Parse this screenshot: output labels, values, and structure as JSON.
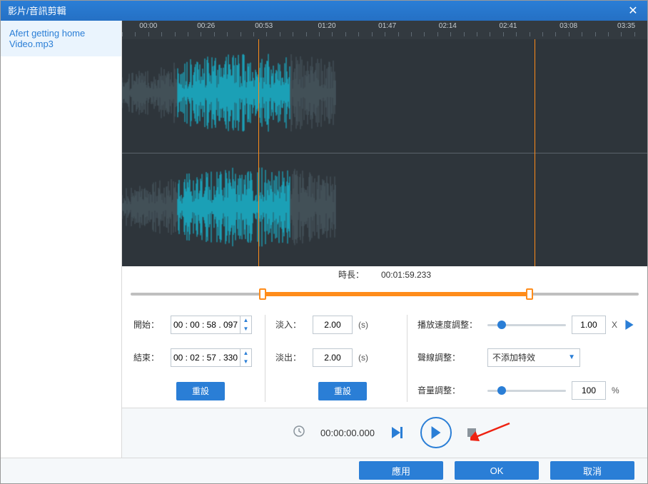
{
  "title": "影片/音訊剪輯",
  "sidebar": {
    "items": [
      {
        "label": "Afert getting home Video.mp3"
      }
    ]
  },
  "ruler": {
    "ticks": [
      "00:00",
      "00:26",
      "00:53",
      "01:20",
      "01:47",
      "02:14",
      "02:41",
      "03:08",
      "03:35"
    ]
  },
  "selection": {
    "left_pct": 26,
    "right_pct": 78.5
  },
  "duration": {
    "label": "時長：",
    "value": "00:01:59.233"
  },
  "trim": {
    "start_label": "開始：",
    "start_value": "00 : 00 : 58 . 097",
    "end_label": "結束：",
    "end_value": "00 : 02 : 57 . 330",
    "reset_label": "重設"
  },
  "fade": {
    "in_label": "淡入：",
    "in_value": "2.00",
    "in_unit": "(s)",
    "out_label": "淡出：",
    "out_value": "2.00",
    "out_unit": "(s)",
    "reset_label": "重設"
  },
  "speed": {
    "label": "播放速度調整：",
    "value": "1.00",
    "unit": "X",
    "knob_pct": 18
  },
  "voice": {
    "label": "聲線調整：",
    "selected": "不添加特效"
  },
  "volume": {
    "label": "音量調整：",
    "value": "100",
    "unit": "%",
    "knob_pct": 18
  },
  "playback": {
    "time": "00:00:00.000"
  },
  "buttons": {
    "apply": "應用",
    "ok": "OK",
    "cancel": "取消"
  }
}
